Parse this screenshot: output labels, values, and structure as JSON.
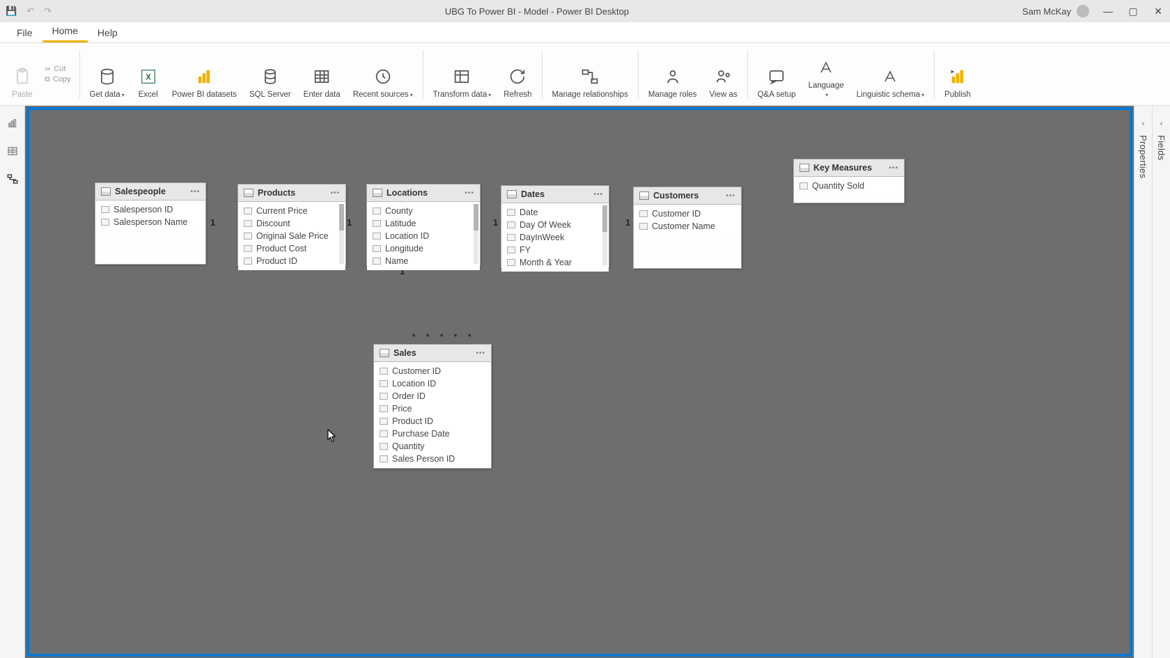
{
  "titlebar": {
    "title": "UBG To Power BI - Model - Power BI Desktop",
    "user": "Sam McKay"
  },
  "menutabs": {
    "file": "File",
    "home": "Home",
    "help": "Help"
  },
  "ribbon": {
    "paste": "Paste",
    "cut": "Cut",
    "copy": "Copy",
    "get_data": "Get data",
    "excel": "Excel",
    "pbi_datasets": "Power BI datasets",
    "sql_server": "SQL Server",
    "enter_data": "Enter data",
    "recent_sources": "Recent sources",
    "transform_data": "Transform data",
    "refresh": "Refresh",
    "manage_relationships": "Manage relationships",
    "manage_roles": "Manage roles",
    "view_as": "View as",
    "qa_setup": "Q&A setup",
    "language": "Language",
    "linguistic_schema": "Linguistic schema",
    "publish": "Publish"
  },
  "panes": {
    "fields": "Fields",
    "properties": "Properties"
  },
  "tables": {
    "salespeople": {
      "name": "Salespeople",
      "fields": [
        "Salesperson ID",
        "Salesperson Name"
      ]
    },
    "products": {
      "name": "Products",
      "fields": [
        "Current Price",
        "Discount",
        "Original Sale Price",
        "Product Cost",
        "Product ID"
      ]
    },
    "locations": {
      "name": "Locations",
      "fields": [
        "County",
        "Latitude",
        "Location ID",
        "Longitude",
        "Name"
      ]
    },
    "dates": {
      "name": "Dates",
      "fields": [
        "Date",
        "Day Of Week",
        "DayInWeek",
        "FY",
        "Month & Year"
      ]
    },
    "customers": {
      "name": "Customers",
      "fields": [
        "Customer ID",
        "Customer Name"
      ]
    },
    "keymeasures": {
      "name": "Key Measures",
      "fields": [
        "Quantity Sold"
      ]
    },
    "sales": {
      "name": "Sales",
      "fields": [
        "Customer ID",
        "Location ID",
        "Order ID",
        "Price",
        "Product ID",
        "Purchase Date",
        "Quantity",
        "Sales Person ID"
      ]
    }
  },
  "cardinality": {
    "one": "1",
    "many": "*"
  }
}
